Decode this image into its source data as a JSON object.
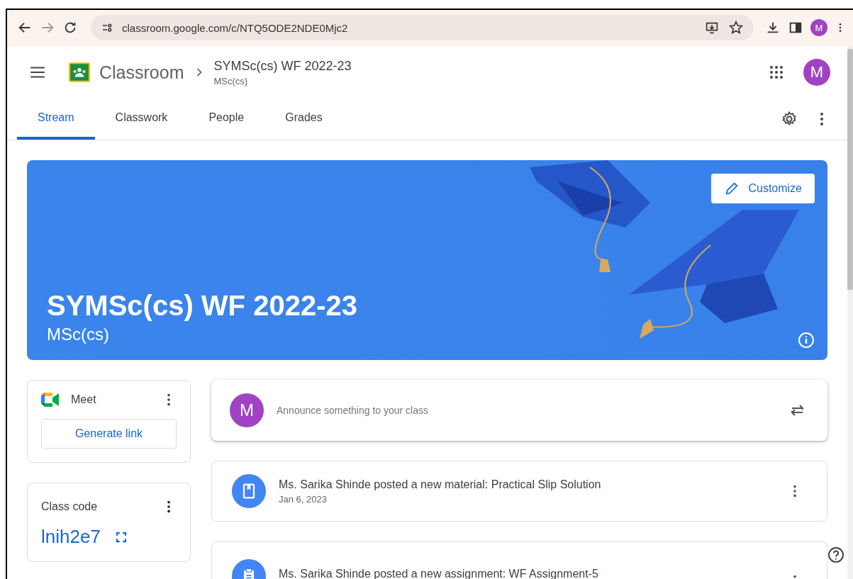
{
  "browser": {
    "url": "classroom.google.com/c/NTQ5ODE2NDE0Mjc2",
    "profile_initial": "M"
  },
  "header": {
    "app_name": "Classroom",
    "class_name": "SYMSc(cs) WF 2022-23",
    "section": "MSc(cs)",
    "avatar_initial": "M"
  },
  "tabs": [
    {
      "label": "Stream",
      "selected": true
    },
    {
      "label": "Classwork",
      "selected": false
    },
    {
      "label": "People",
      "selected": false
    },
    {
      "label": "Grades",
      "selected": false
    }
  ],
  "banner": {
    "title": "SYMSc(cs) WF 2022-23",
    "subtitle": "MSc(cs)",
    "customize_label": "Customize"
  },
  "meet": {
    "title": "Meet",
    "button": "Generate link"
  },
  "class_code": {
    "label": "Class code",
    "code": "lnih2e7"
  },
  "announce": {
    "avatar_initial": "M",
    "placeholder": "Announce something to your class"
  },
  "posts": [
    {
      "kind": "material",
      "text": "Ms. Sarika Shinde posted a new material: Practical Slip Solution",
      "date": "Jan 6, 2023"
    },
    {
      "kind": "assignment",
      "text": "Ms. Sarika Shinde posted a new assignment: WF Assignment-5"
    }
  ]
}
